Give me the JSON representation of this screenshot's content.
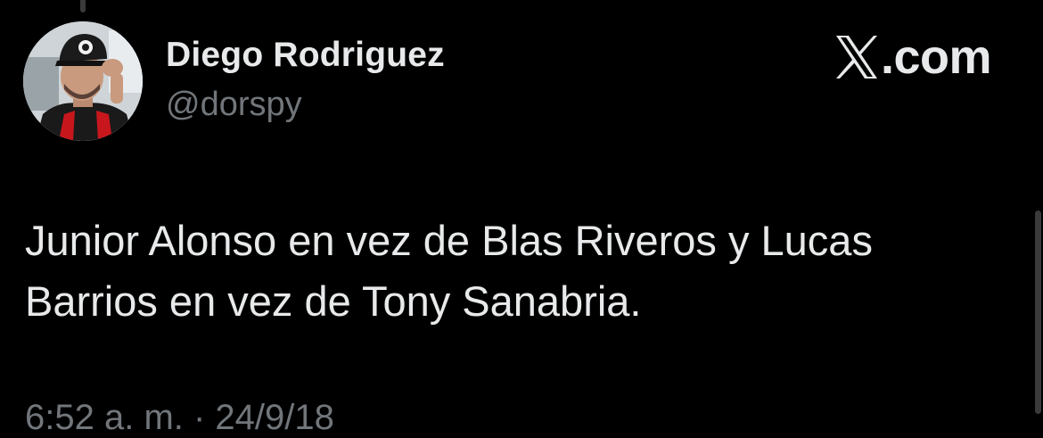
{
  "tweet": {
    "author": {
      "display_name": "Diego Rodriguez",
      "handle": "@dorspy"
    },
    "brand": {
      "label": ".com",
      "logo_icon": "x-logo-icon"
    },
    "text": "Junior Alonso en vez de Blas Riveros y Lucas\nBarrios en vez de Tony Sanabria.",
    "meta": "6:52 a. m. · 24/9/18"
  },
  "colors": {
    "background": "#000000",
    "primary_text": "#e7e9ea",
    "secondary_text": "#71767b"
  }
}
